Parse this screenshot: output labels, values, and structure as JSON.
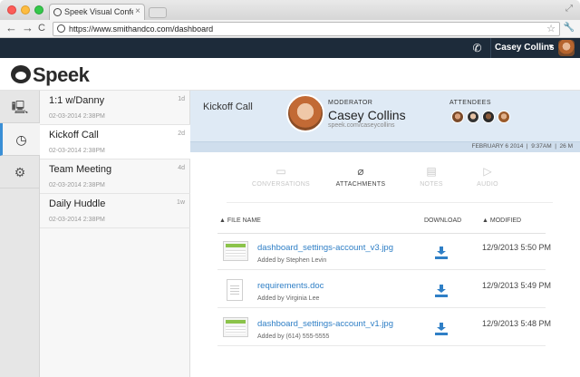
{
  "browser": {
    "tab_title": "Speek Visual Conferenc",
    "url": "https://www.smithandco.com/dashboard"
  },
  "header": {
    "user_name": "Casey Collins",
    "dark_color": "#1d2b3a"
  },
  "logo": {
    "text": "Speek"
  },
  "sidebar": {
    "icons": [
      "computer-icon",
      "clock-icon",
      "gear-icon"
    ],
    "active_index": 1
  },
  "calls": [
    {
      "title": "1:1 w/Danny",
      "age": "1d",
      "date": "02-03-2014  2:38PM"
    },
    {
      "title": "Kickoff Call",
      "age": "2d",
      "date": "02-03-2014  2:38PM"
    },
    {
      "title": "Team Meeting",
      "age": "4d",
      "date": "02-03-2014  2:38PM"
    },
    {
      "title": "Daily Huddle",
      "age": "1w",
      "date": "02-03-2014  2:38PM"
    }
  ],
  "main": {
    "title": "Kickoff Call",
    "moderator_label": "MODERATOR",
    "moderator_name": "Casey Collins",
    "moderator_link": "speek.com/caseycollins",
    "attendees_label": "ATTENDEES",
    "info": "FEBRUARY 6 2014  |  9:37AM  |  26 M",
    "tabs": [
      {
        "label": "CONVERSATIONS",
        "icon": "chat-icon"
      },
      {
        "label": "ATTACHMENTS",
        "icon": "paperclip-icon"
      },
      {
        "label": "NOTES",
        "icon": "notes-icon"
      },
      {
        "label": "AUDIO",
        "icon": "play-icon"
      }
    ],
    "active_tab": 1,
    "columns": {
      "file_name": "▲ FILE NAME",
      "download": "DOWNLOAD",
      "modified": "▲ MODIFIED"
    },
    "files": [
      {
        "name": "dashboard_settings-account_v3.jpg",
        "added_by": "Added by Stephen Levin",
        "modified": "12/9/2013 5:50 PM",
        "type": "image"
      },
      {
        "name": "requirements.doc",
        "added_by": "Added by Virginia Lee",
        "modified": "12/9/2013 5:49 PM",
        "type": "doc"
      },
      {
        "name": "dashboard_settings-account_v1.jpg",
        "added_by": "Added by (614) 555-5555",
        "modified": "12/9/2013 5:48 PM",
        "type": "image"
      }
    ]
  },
  "colors": {
    "link": "#2f7fc6",
    "panel_blue": "#dfeaf5",
    "active_accent": "#3a8fd6"
  }
}
